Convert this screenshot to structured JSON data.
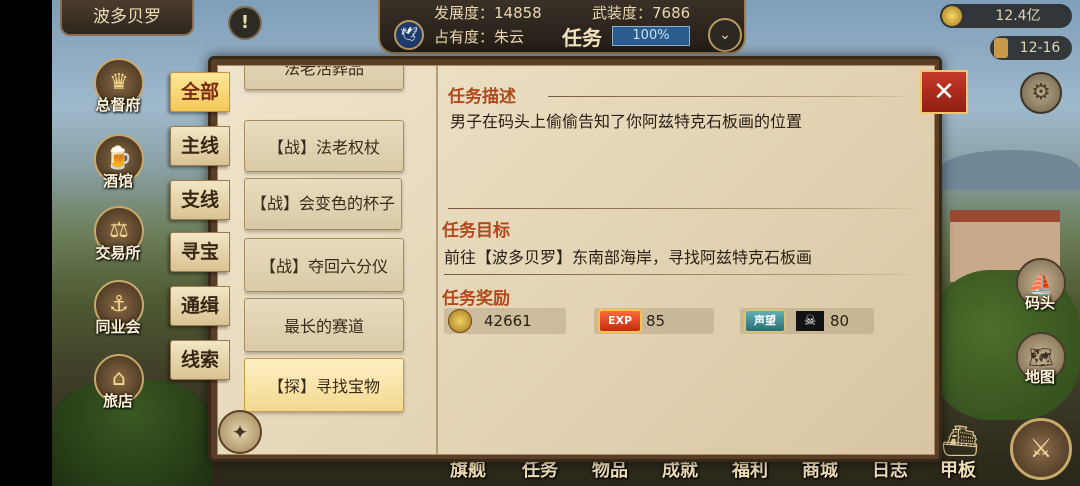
{
  "top": {
    "city_name": "波多贝罗",
    "alert_icon": "!",
    "development_label": "发展度：14858",
    "armament_label": "武装度：7686",
    "occupancy_label": "占有度：朱云",
    "panel_title": "任务",
    "occupancy_percent": "100%",
    "gold": "12.4亿",
    "date": "12-16"
  },
  "left_nav": [
    {
      "label": "总督府",
      "icon": "crown-icon"
    },
    {
      "label": "酒馆",
      "icon": "tavern-icon"
    },
    {
      "label": "交易所",
      "icon": "scales-icon"
    },
    {
      "label": "同业会",
      "icon": "guild-icon"
    },
    {
      "label": "旅店",
      "icon": "inn-icon"
    }
  ],
  "right_nav": [
    {
      "label": "码头",
      "icon": "dock-icon"
    },
    {
      "label": "地图",
      "icon": "map-icon"
    }
  ],
  "categories": [
    {
      "label": "全部",
      "active": true
    },
    {
      "label": "主线",
      "active": false
    },
    {
      "label": "支线",
      "active": false
    },
    {
      "label": "寻宝",
      "active": false
    },
    {
      "label": "通缉",
      "active": false
    },
    {
      "label": "线索",
      "active": false
    }
  ],
  "quests": [
    {
      "label": "法老活葬品",
      "active": false
    },
    {
      "label": "【战】法老权杖",
      "active": false
    },
    {
      "label": "【战】会变色的杯子",
      "active": false
    },
    {
      "label": "【战】夺回六分仪",
      "active": false
    },
    {
      "label": "最长的赛道",
      "active": false
    },
    {
      "label": "【探】寻找宝物",
      "active": true
    }
  ],
  "detail": {
    "desc_title": "任务描述",
    "desc_text": "男子在码头上偷偷告知了你阿兹特克石板画的位置",
    "goal_title": "任务目标",
    "goal_text": "前往【波多贝罗】东南部海岸，寻找阿兹特克石板画",
    "reward_title": "任务奖励",
    "rewards": {
      "gold": "42661",
      "exp_badge": "EXP",
      "exp": "85",
      "fame_badge": "声望",
      "fame": "80"
    }
  },
  "bottom_nav": [
    "旗舰",
    "任务",
    "物品",
    "成就",
    "福利",
    "商城",
    "日志",
    "甲板"
  ],
  "colors": {
    "accent": "#b04a1c",
    "tab_active": "#f2c85a",
    "close": "#c6392a"
  }
}
